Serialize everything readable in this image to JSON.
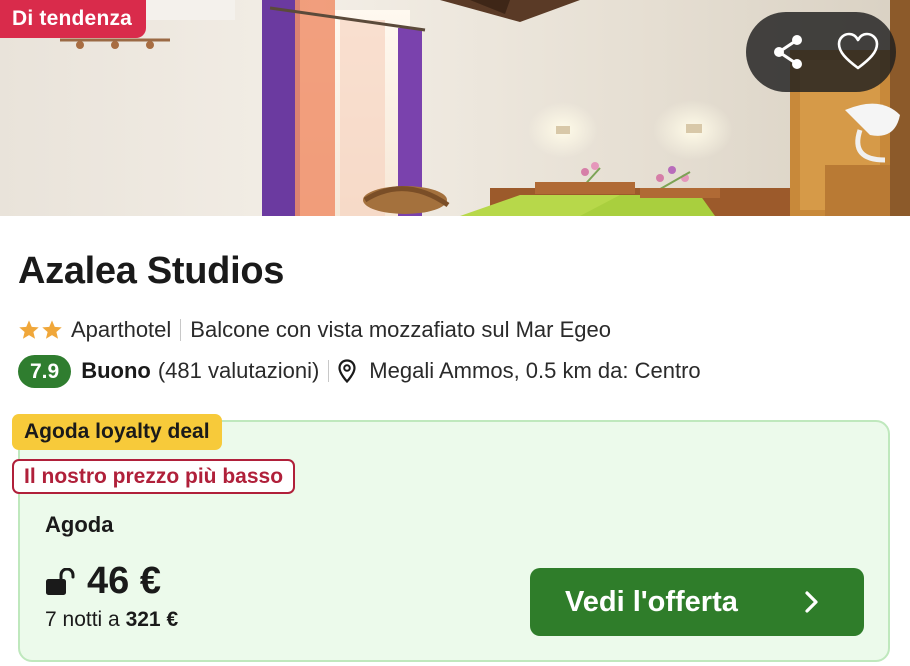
{
  "hero": {
    "badge": "Di tendenza",
    "share_icon": "share-icon",
    "favorite_icon": "heart-icon"
  },
  "hotel": {
    "name": "Azalea Studios",
    "star_count": 2,
    "type": "Aparthotel",
    "highlight": "Balcone con vista mozzafiato sul Mar Egeo",
    "score": "7.9",
    "score_label": "Buono",
    "reviews": "(481 valutazioni)",
    "location": "Megali Ammos, 0.5 km da: Centro"
  },
  "deal": {
    "loyalty_tag": "Agoda loyalty deal",
    "lowest_tag": "Il nostro prezzo più basso",
    "provider": "Agoda",
    "price": "46 €",
    "nights_text": "7 notti a",
    "total": "321 €",
    "cta_label": "Vedi l'offerta"
  },
  "colors": {
    "trending": "#d92b4b",
    "score_green": "#2f7d2f",
    "loyalty_yellow": "#f7ca3a",
    "lowest_red": "#b0203a",
    "card_bg": "#ecfaeb",
    "cta_green": "#2f7d2a",
    "star_orange": "#f0a73a"
  }
}
